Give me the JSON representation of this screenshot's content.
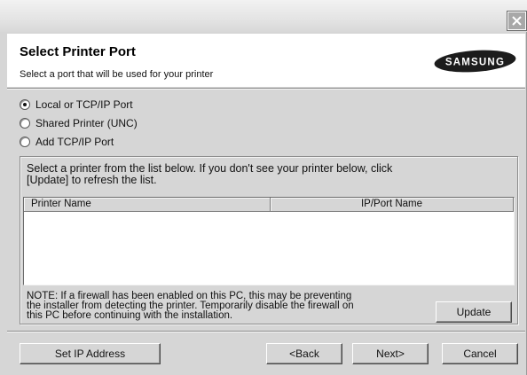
{
  "window": {
    "close_icon": "close-icon"
  },
  "header": {
    "title": "Select Printer Port",
    "subtitle": "Select a port that will be used for your printer",
    "logo_text": "SAMSUNG"
  },
  "port_options": [
    {
      "label": "Local or TCP/IP Port",
      "selected": true
    },
    {
      "label": "Shared Printer (UNC)",
      "selected": false
    },
    {
      "label": "Add TCP/IP Port",
      "selected": false
    }
  ],
  "printer_list": {
    "instructions": "Select a printer from the list below. If you don't see your printer below, click\n[Update] to refresh the list.",
    "columns": [
      "Printer Name",
      "IP/Port Name"
    ],
    "rows": []
  },
  "note": "NOTE: If a firewall has been enabled on this PC, this may be preventing\nthe installer from detecting the printer. Temporarily disable the firewall on\nthis PC before continuing with the installation.",
  "buttons": {
    "update": "Update",
    "set_ip": "Set IP Address",
    "back": "<Back",
    "next": "Next>",
    "cancel": "Cancel"
  }
}
